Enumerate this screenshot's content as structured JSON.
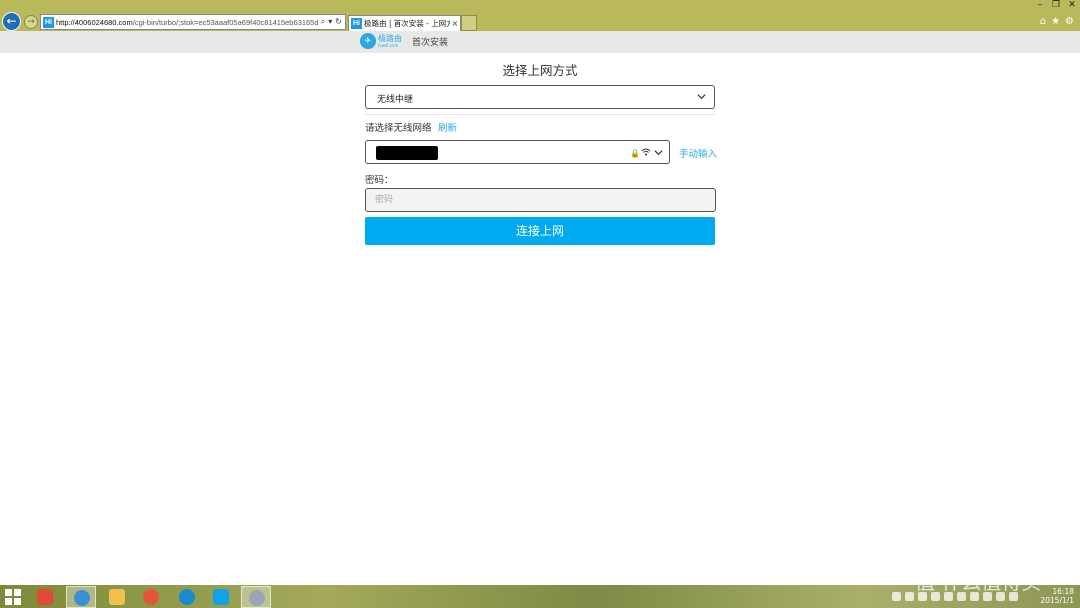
{
  "browser": {
    "address_url_host": "http://4006024680.com",
    "address_url_path": "/cgi-bin/turbo/;stok=ec53aaaf05a69f40c81415eb63165d",
    "tab_title": "极路由 | 首次安装 - 上网方...",
    "favicon_text": "Hi"
  },
  "header": {
    "logo_text": "极路由",
    "logo_sub": "hiwifi.com",
    "breadcrumb": "首次安装"
  },
  "form": {
    "title": "选择上网方式",
    "mode_selected": "无线中继",
    "wifi_label": "请选择无线网络",
    "refresh_label": "刷新",
    "manual_label": "手动输入",
    "password_label": "密码：",
    "password_placeholder": "密码",
    "connect_label": "连接上网"
  },
  "taskbar": {
    "time": "16:18",
    "date": "2015/1/1"
  },
  "watermark": "值 什么值得买"
}
